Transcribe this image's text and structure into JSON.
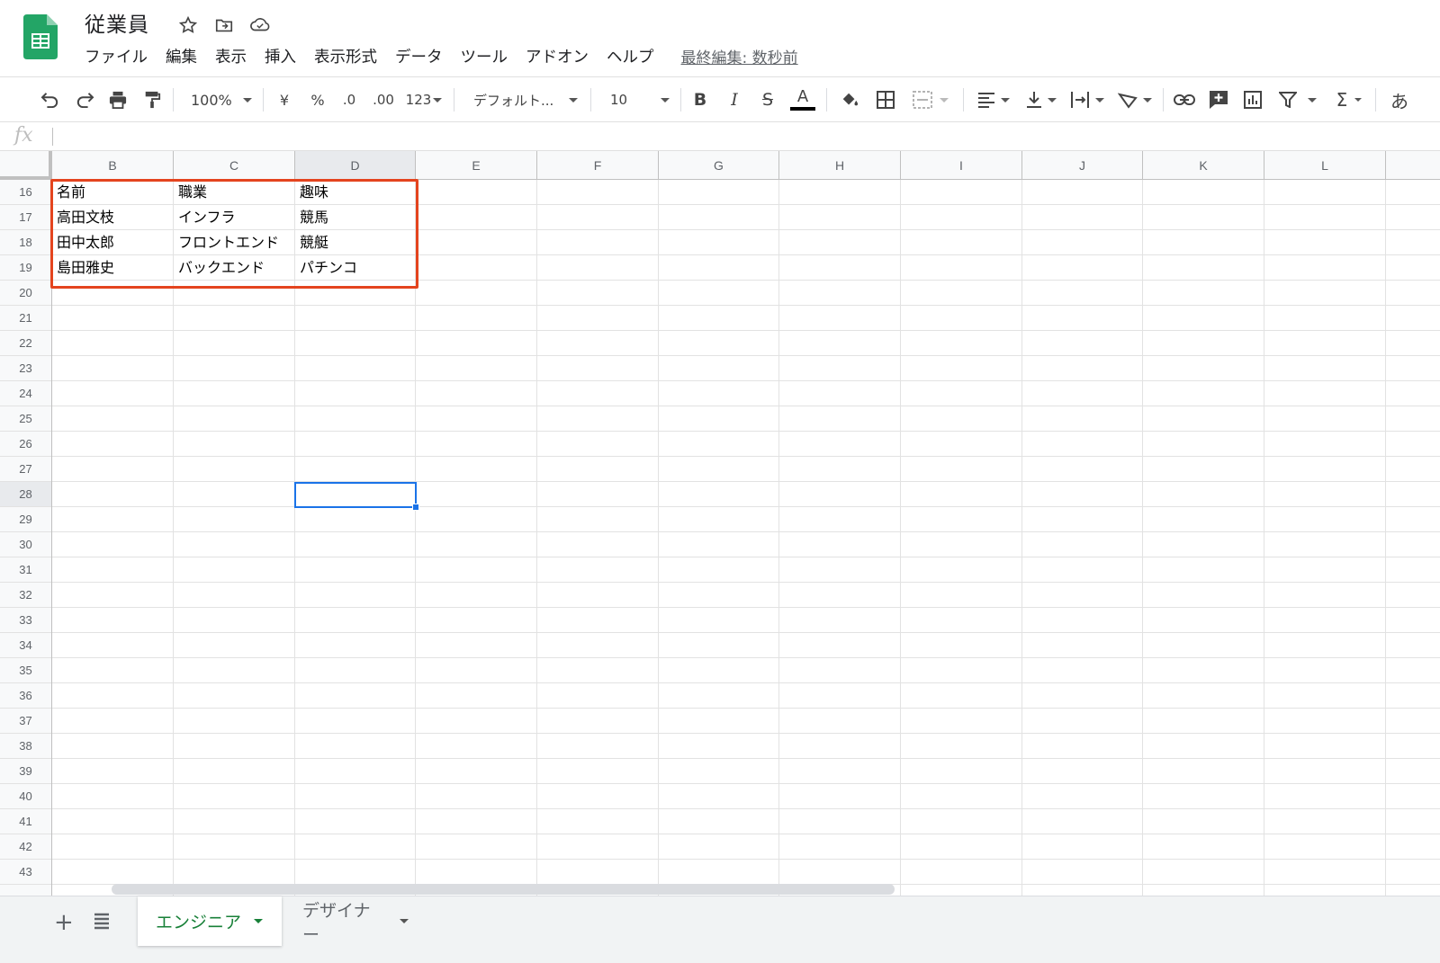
{
  "doc": {
    "title": "従業員",
    "last_edit": "最終編集: 数秒前"
  },
  "menu": [
    "ファイル",
    "編集",
    "表示",
    "挿入",
    "表示形式",
    "データ",
    "ツール",
    "アドオン",
    "ヘルプ"
  ],
  "toolbar": {
    "zoom": "100%",
    "currency": "¥",
    "percent": "%",
    "decimal_decrease": ".0",
    "decimal_increase": ".00",
    "number_format": "123",
    "font": "デフォルト...",
    "font_size": "10",
    "input_tools": "あ"
  },
  "columns": [
    "B",
    "C",
    "D",
    "E",
    "F",
    "G",
    "H",
    "I",
    "J",
    "K",
    "L"
  ],
  "rows": [
    "16",
    "17",
    "18",
    "19",
    "20",
    "21",
    "22",
    "23",
    "24",
    "25",
    "26",
    "27",
    "28",
    "29",
    "30",
    "31",
    "32",
    "33",
    "34",
    "35",
    "36",
    "37",
    "38",
    "39",
    "40",
    "41",
    "42",
    "43"
  ],
  "table": [
    [
      "名前",
      "職業",
      "趣味"
    ],
    [
      "高田文枝",
      "インフラ",
      "競馬"
    ],
    [
      "田中太郎",
      "フロントエンド",
      "競艇"
    ],
    [
      "島田雅史",
      "バックエンド",
      "パチンコ"
    ]
  ],
  "sheets": {
    "active": "エンジニア",
    "other": "デザイナー"
  },
  "colors": {
    "brand_green": "#188038",
    "selection_blue": "#1a73e8",
    "highlight_red": "#e4441e"
  }
}
